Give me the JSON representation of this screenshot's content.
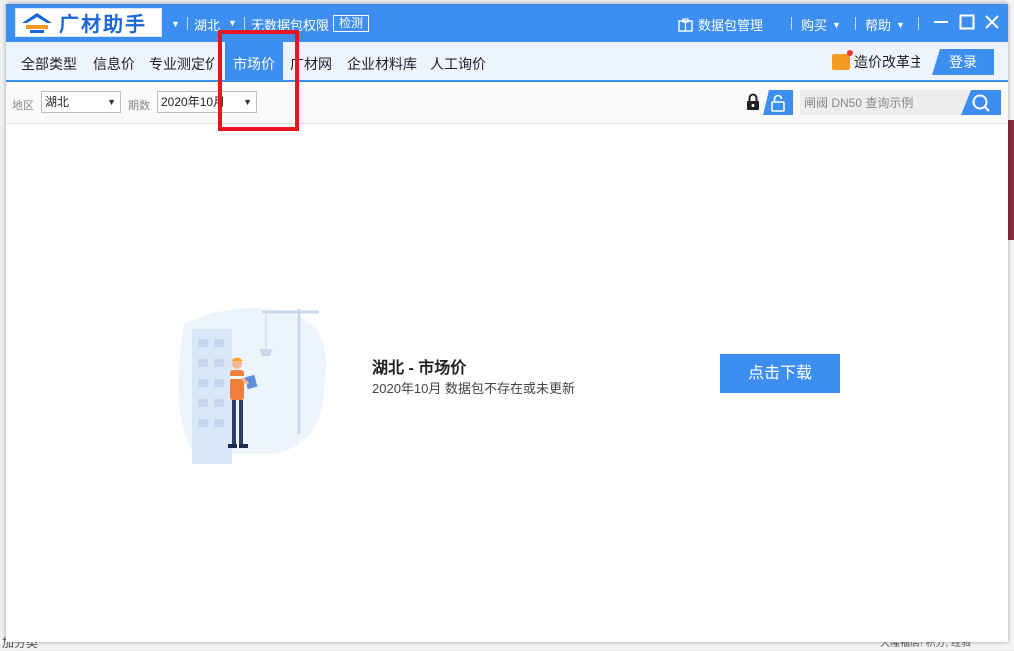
{
  "app": {
    "logo_text": "广材助手",
    "region": "湖北",
    "permission_text": "无数据包权限",
    "check_label": "检测",
    "package_manage": "数据包管理",
    "buy": "购买",
    "help": "帮助"
  },
  "nav": {
    "tabs": [
      {
        "label": "全部类型"
      },
      {
        "label": "信息价"
      },
      {
        "label": "专业测定价"
      },
      {
        "label": "市场价"
      },
      {
        "label": "广材网"
      },
      {
        "label": "企业材料库"
      },
      {
        "label": "人工询价"
      }
    ],
    "active_tab": "市场价",
    "banner_text": "造价改革主",
    "login_label": "登录"
  },
  "filters": {
    "region_label": "地区",
    "region_value": "湖北",
    "period_label": "期数",
    "period_value": "2020年10月",
    "search_placeholder": "闸阀 DN50 查询示例"
  },
  "content": {
    "title": "湖北 - 市场价",
    "subtitle": "2020年10月 数据包不存在或未更新",
    "download_label": "点击下载"
  },
  "background": {
    "bottom_left_text": "加分类",
    "bottom_right_text": "大隆福店! 积分, 经验"
  },
  "colors": {
    "primary": "#3d8ef1",
    "highlight": "#e8141e"
  }
}
